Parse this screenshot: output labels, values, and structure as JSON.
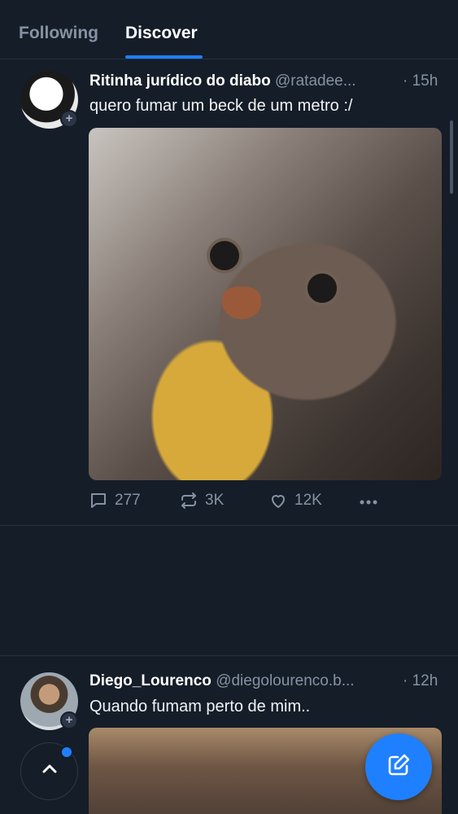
{
  "tabs": {
    "following": "Following",
    "discover": "Discover",
    "active": "Discover"
  },
  "posts": [
    {
      "author": "Ritinha jurídico do diabo",
      "handle": "@ratadee...",
      "time": "· 15h",
      "text": "quero fumar um beck de um metro :/",
      "media": "cat-photo",
      "replies": "277",
      "reposts": "3K",
      "likes": "12K"
    },
    {
      "author": "Diego_Lourenco",
      "handle": "@diegolourenco.b...",
      "time": "· 12h",
      "text": "Quando fumam perto de mim..",
      "media": "animal-photo"
    }
  ],
  "colors": {
    "background": "#151d28",
    "accent": "#1f80ff",
    "muted_text": "#8592a3",
    "divider": "#263140"
  },
  "icons": [
    "reply-icon",
    "repost-icon",
    "like-icon",
    "more-icon",
    "chevron-up-icon",
    "compose-icon",
    "plus-icon"
  ]
}
